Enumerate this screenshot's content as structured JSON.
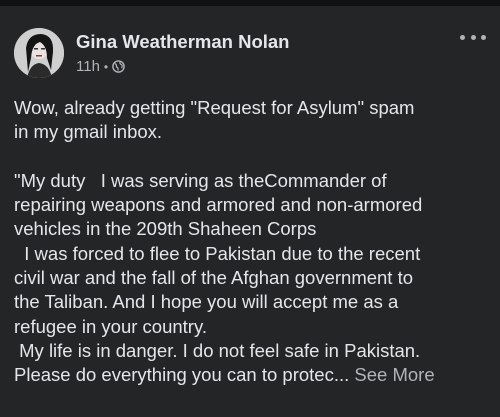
{
  "post": {
    "author": "Gina Weatherman Nolan",
    "time": "11h",
    "separator": "•",
    "privacy_icon": "globe-icon",
    "more_icon": "more-options-icon",
    "paragraph1": [
      "Wow, already getting \"Request for Asylum\" spam",
      "in my gmail inbox."
    ],
    "paragraph2": [
      "\"My duty   I was serving as theCommander of",
      "repairing weapons and armored and non-armored",
      "vehicles in the 209th Shaheen Corps",
      "  I was forced to flee to Pakistan due to the recent",
      "civil war and the fall of the Afghan government to",
      "the Taliban. And I hope you will accept me as a",
      "refugee in your country.",
      " My life is in danger. I do not feel safe in Pakistan."
    ],
    "last_line": "Please do everything you can to protec...",
    "see_more": "See More"
  },
  "colors": {
    "background": "#242526",
    "text": "#e4e6eb",
    "secondary": "#b0b3b8"
  }
}
